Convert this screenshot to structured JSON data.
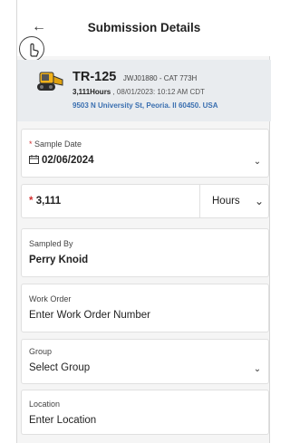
{
  "header": {
    "title": "Submission Details",
    "back_icon": "arrow-left-icon",
    "touch_icon": "tap-hand-icon"
  },
  "equipment": {
    "id": "TR-125",
    "serial": "JWJ01880 - CAT 773H",
    "hours": "3,111Hours",
    "timestamp": ", 08/01/2023: 10:12 AM CDT",
    "address": "9503 N University St, Peoria. Il 60450. USA",
    "icon": "skid-steer-loader-icon"
  },
  "form": {
    "sample_date": {
      "required_mark": "*",
      "label": "Sample Date",
      "value": "02/06/2024",
      "icon": "calendar-icon"
    },
    "reading": {
      "required_mark": "*",
      "value": "3,111",
      "unit": "Hours"
    },
    "sampled_by": {
      "label": "Sampled By",
      "value": "Perry Knoid"
    },
    "work_order": {
      "label": "Work Order",
      "placeholder": "Enter Work Order Number"
    },
    "group": {
      "label": "Group",
      "value": "Select Group"
    },
    "location": {
      "label": "Location",
      "placeholder": "Enter Location"
    }
  },
  "colors": {
    "required": "#d32f2f",
    "link": "#3a6fb0",
    "equipment_bg": "#e9ecef"
  }
}
